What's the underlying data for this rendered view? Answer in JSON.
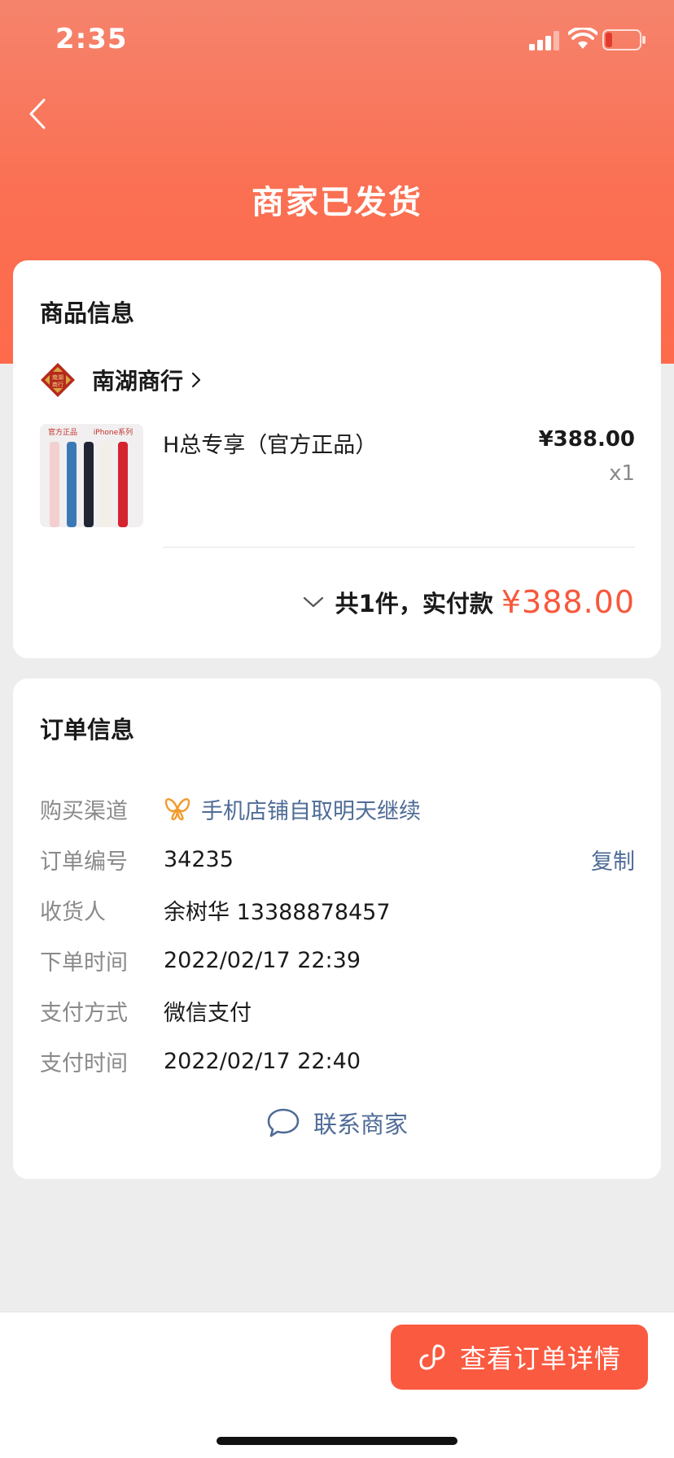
{
  "status_bar": {
    "time": "2:35"
  },
  "header": {
    "title": "商家已发货"
  },
  "product_card": {
    "title": "商品信息",
    "shop_name": "南湖商行",
    "shop_logo_text": "南湖商行",
    "product_image_labels": [
      "官方正品",
      "iPhone系列"
    ],
    "product_name": "H总专享（官方正品）",
    "price": "¥388.00",
    "quantity": "x1",
    "total_label": "共1件，实付款",
    "total_amount": "¥388.00"
  },
  "order_card": {
    "title": "订单信息",
    "rows": [
      {
        "label": "购买渠道",
        "value": "手机店铺自取明天继续"
      },
      {
        "label": "订单编号",
        "value": "34235",
        "action": "复制"
      },
      {
        "label": "收货人",
        "value": "余树华 13388878457"
      },
      {
        "label": "下单时间",
        "value": "2022/02/17 22:39"
      },
      {
        "label": "支付方式",
        "value": "微信支付"
      },
      {
        "label": "支付时间",
        "value": "2022/02/17 22:40"
      }
    ],
    "contact_label": "联系商家"
  },
  "bottom_bar": {
    "detail_button_label": "查看订单详情"
  },
  "colors": {
    "accent": "#fa5a40",
    "header_top": "#f5836c",
    "header_bottom": "#fe6a4c",
    "link": "#4f6c97",
    "price": "#f8573b"
  },
  "icons": [
    "back-icon",
    "signal-icon",
    "wifi-icon",
    "battery-icon",
    "chevron-right-icon",
    "chevron-down-icon",
    "butterfly-icon",
    "chat-bubble-icon",
    "link-icon"
  ]
}
